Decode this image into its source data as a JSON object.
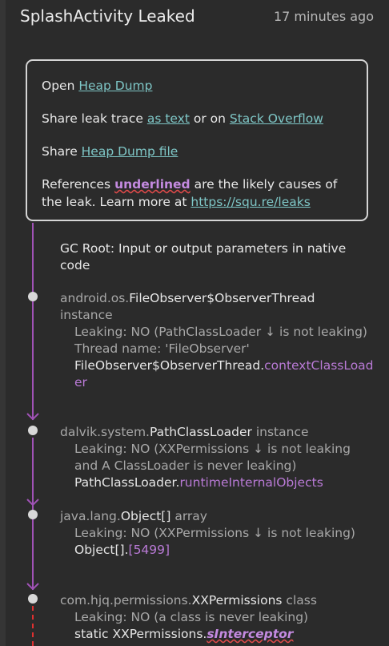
{
  "header": {
    "title": "SplashActivity Leaked",
    "time": "17 minutes ago"
  },
  "info": {
    "open_prefix": "Open ",
    "heap_dump_link": "Heap Dump",
    "share_prefix": "Share leak trace ",
    "as_text_link": "as text",
    "share_mid": " or on ",
    "stack_overflow_link": "Stack Overflow",
    "share_file_prefix": "Share ",
    "heap_dump_file_link": "Heap Dump file",
    "refs_prefix": "References ",
    "underlined": "underlined",
    "refs_suffix": " are the likely causes of the leak. Learn more at ",
    "leaks_link": "https://squ.re/leaks"
  },
  "trace": {
    "gc_root": "GC Root: Input or output parameters in native code",
    "n1": {
      "pkg": "android.os.",
      "cls": "FileObserver$ObserverThread",
      "kind": "instance",
      "leaking": "Leaking: NO (PathClassLoader ↓ is not leaking)",
      "thread": "Thread name: 'FileObserver'",
      "ref_owner": "FileObserver$ObserverThread.",
      "ref_field": "contextClassLoader"
    },
    "n2": {
      "pkg": "dalvik.system.",
      "cls": "PathClassLoader",
      "kind": " instance",
      "leaking": "Leaking: NO (XXPermissions ↓ is not leaking and A ClassLoader is never leaking)",
      "ref_owner": "PathClassLoader.",
      "ref_field": "runtimeInternalObjects"
    },
    "n3": {
      "pkg": "java.lang.",
      "cls": "Object[]",
      "kind": " array",
      "leaking": "Leaking: NO (XXPermissions ↓ is not leaking)",
      "ref_owner": "Object[].",
      "ref_field": "[5499]"
    },
    "n4": {
      "pkg": "com.hjq.permissions.",
      "cls": "XXPermissions",
      "kind": " class",
      "leaking": "Leaking: NO (a class is never leaking)",
      "ref_owner": "static XXPermissions.",
      "ref_field": "sInterceptor"
    }
  },
  "colors": {
    "link": "#7ec6c6",
    "trace_line": "#a052b6",
    "field": "#b97ad6",
    "leak_line": "#e03030",
    "wavy": "#e04a4a"
  }
}
